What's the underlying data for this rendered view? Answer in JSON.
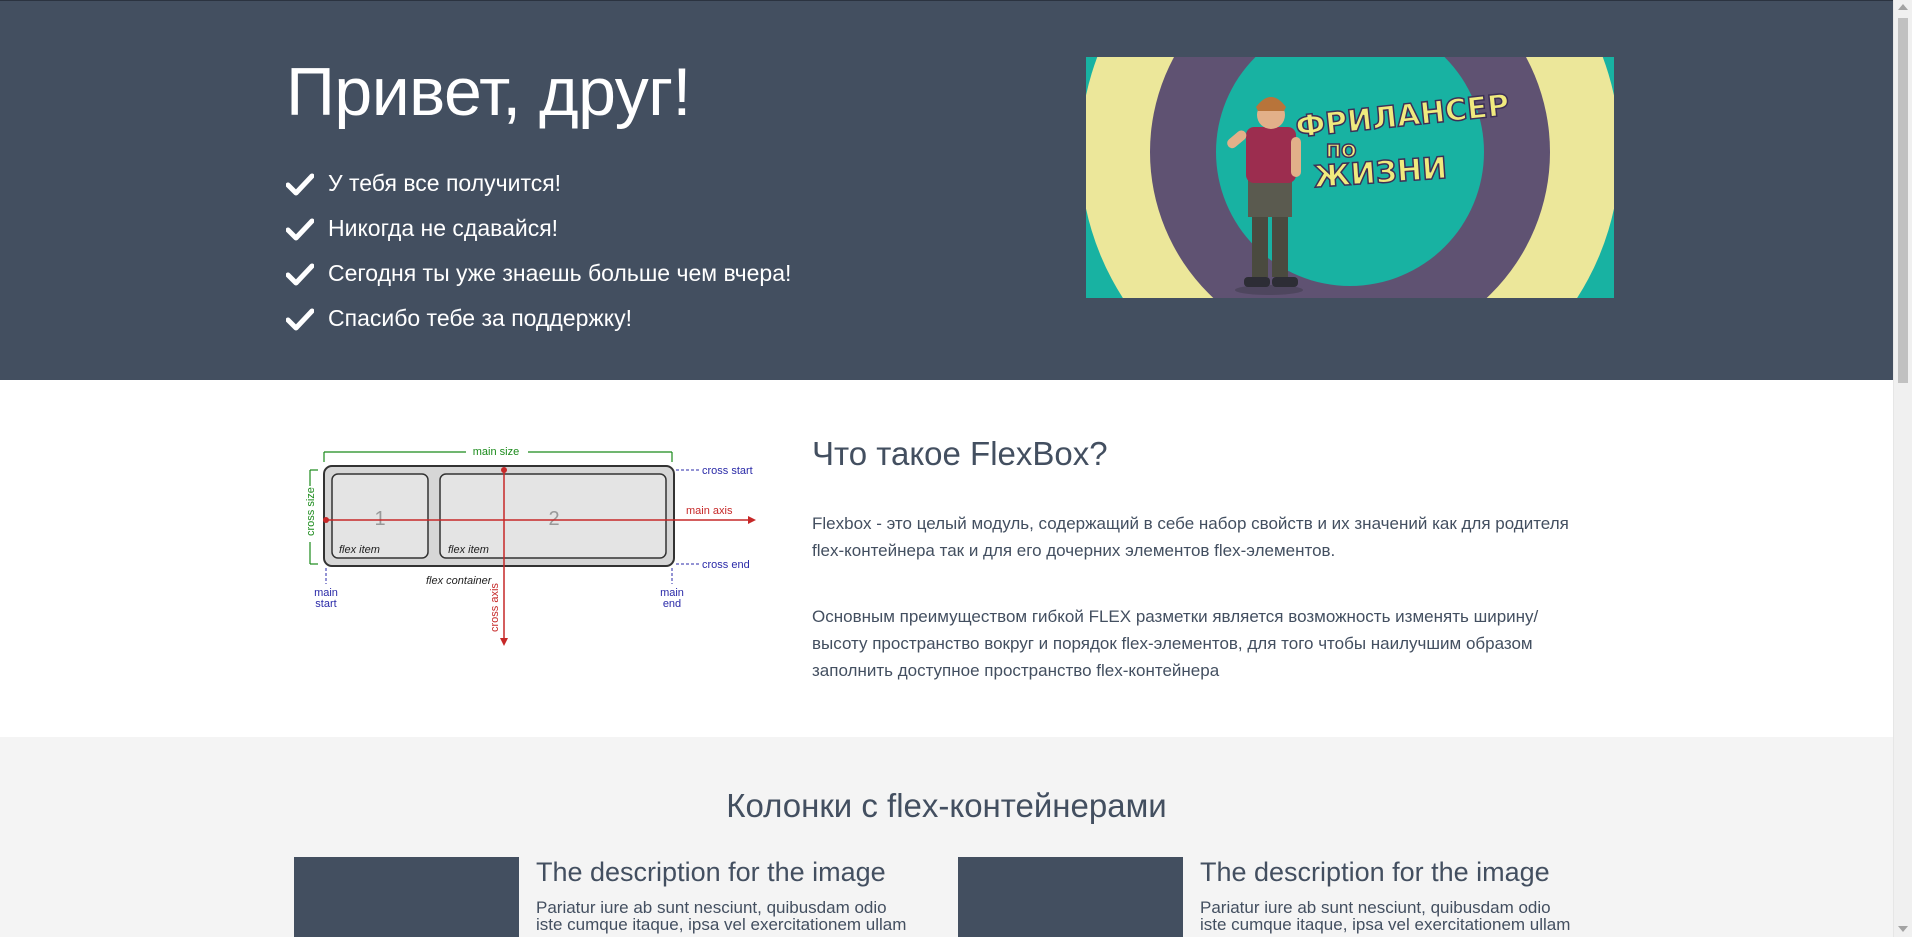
{
  "hero": {
    "title": "Привет, друг!",
    "items": [
      "У тебя все получится!",
      "Никогда не сдавайся!",
      "Сегодня ты уже знаешь больше чем вчера!",
      "Спасибо тебе за поддержку!"
    ],
    "banner_text_line1": "ФРИЛАНСЕР",
    "banner_text_line2": "ПО",
    "banner_text_line3": "ЖИЗНИ"
  },
  "flexbox": {
    "title": "Что такое FlexBox?",
    "paragraph1": "Flexbox - это целый модуль, содержащий в себе набор свойств и их значений как для родителя flex-контейнера так и для его дочерних элементов flex-элементов.",
    "paragraph2": "Основным преимуществом гибкой FLEX разметки является возможность изменять ширину/высоту пространство вокруг и порядок flex-элементов, для того чтобы наилучшим образом заполнить доступное пространство flex-контейнера",
    "diagram": {
      "main_size": "main size",
      "cross_start": "cross start",
      "cross_size": "cross size",
      "main_axis": "main axis",
      "cross_end": "cross end",
      "item1_number": "1",
      "item2_number": "2",
      "flex_item": "flex item",
      "flex_container": "flex container",
      "main_start_1": "main",
      "main_start_2": "start",
      "main_end_1": "main",
      "main_end_2": "end",
      "cross_axis": "cross axis"
    }
  },
  "columns": {
    "title": "Колонки с flex-контейнерами",
    "cards": [
      {
        "title": "The description for the image",
        "line1": "Pariatur iure ab sunt nesciunt, quibusdam odio",
        "line2": "iste cumque itaque, ipsa vel exercitationem ullam"
      },
      {
        "title": "The description for the image",
        "line1": "Pariatur iure ab sunt nesciunt, quibusdam odio",
        "line2": "iste cumque itaque, ipsa vel exercitationem ullam"
      }
    ]
  },
  "colors": {
    "hero_bg": "#434f60",
    "accent_teal": "#18b2a2",
    "banner_purple": "#5f5272",
    "banner_yellow": "#ece79a",
    "section_gray": "#f4f4f4"
  }
}
